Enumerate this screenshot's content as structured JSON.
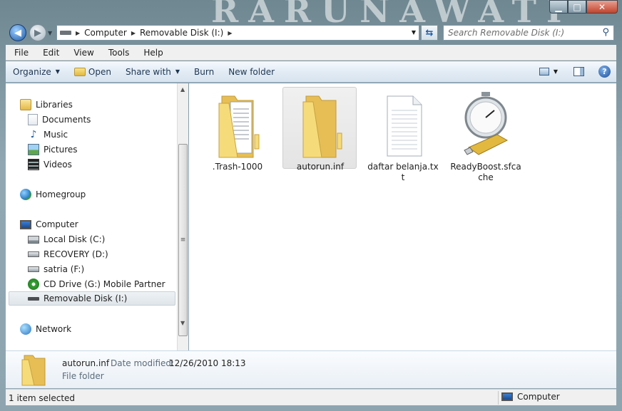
{
  "background_title": "RARUNAWATI",
  "window_controls": {
    "minimize": "▁",
    "maximize": "□",
    "close": "✕"
  },
  "address": {
    "segments": [
      "Computer",
      "Removable Disk (I:)"
    ]
  },
  "search": {
    "placeholder": "Search Removable Disk (I:)"
  },
  "menu": [
    "File",
    "Edit",
    "View",
    "Tools",
    "Help"
  ],
  "commands": {
    "organize": "Organize",
    "open": "Open",
    "share_with": "Share with",
    "burn": "Burn",
    "new_folder": "New folder"
  },
  "nav": {
    "libraries": "Libraries",
    "library_items": [
      "Documents",
      "Music",
      "Pictures",
      "Videos"
    ],
    "homegroup": "Homegroup",
    "computer": "Computer",
    "drives": [
      "Local Disk (C:)",
      "RECOVERY (D:)",
      "satria (F:)",
      "CD Drive (G:) Mobile Partner",
      "Removable Disk (I:)"
    ],
    "network": "Network",
    "selected": "Removable Disk (I:)"
  },
  "files": [
    {
      "name": ".Trash-1000",
      "kind": "folder-with-docs"
    },
    {
      "name": "autorun.inf",
      "kind": "folder",
      "selected": true
    },
    {
      "name": "daftar belanja.txt",
      "kind": "text-file"
    },
    {
      "name": "ReadyBoost.sfcache",
      "kind": "readyboost"
    }
  ],
  "details": {
    "name": "autorun.inf",
    "modified_label": "Date modified:",
    "modified": "12/26/2010 18:13",
    "type": "File folder"
  },
  "status": {
    "selection": "1 item selected",
    "location": "Computer"
  },
  "colors": {
    "selection": "#e4e4e4",
    "accent": "#1d5ba8",
    "folder": "#f3d573"
  }
}
